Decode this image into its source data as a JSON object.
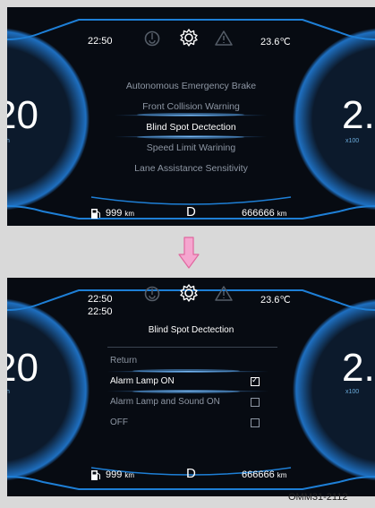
{
  "status": {
    "time": "22:50",
    "temperature": "23.6℃"
  },
  "gauges": {
    "left_value": "20",
    "left_unit": "h",
    "right_value": "2.",
    "right_unit": "x100"
  },
  "menu": {
    "items": [
      {
        "label": "Autonomous Emergency Brake",
        "selected": false
      },
      {
        "label": "Front Collision Warning",
        "selected": false
      },
      {
        "label": "Blind Spot Dectection",
        "selected": true
      },
      {
        "label": "Speed Limit Warining",
        "selected": false
      },
      {
        "label": "Lane Assistance Sensitivity",
        "selected": false
      }
    ]
  },
  "submenu": {
    "title": "Blind Spot Dectection",
    "options": [
      {
        "label": "Return",
        "checkbox": false,
        "checked": false,
        "selected": false
      },
      {
        "label": "Alarm Lamp ON",
        "checkbox": true,
        "checked": true,
        "selected": true
      },
      {
        "label": "Alarm Lamp and Sound ON",
        "checkbox": true,
        "checked": false,
        "selected": false
      },
      {
        "label": "OFF",
        "checkbox": true,
        "checked": false,
        "selected": false
      }
    ]
  },
  "bottom": {
    "fuel_range": "999",
    "fuel_unit": "km",
    "gear": "D",
    "odometer": "666666",
    "odometer_unit": "km"
  },
  "figure_code": "OMM31-2112",
  "colors": {
    "accent_blue": "#1e7fd6",
    "arrow_pink": "#f08ac0",
    "panel_bg": "#070b12"
  }
}
